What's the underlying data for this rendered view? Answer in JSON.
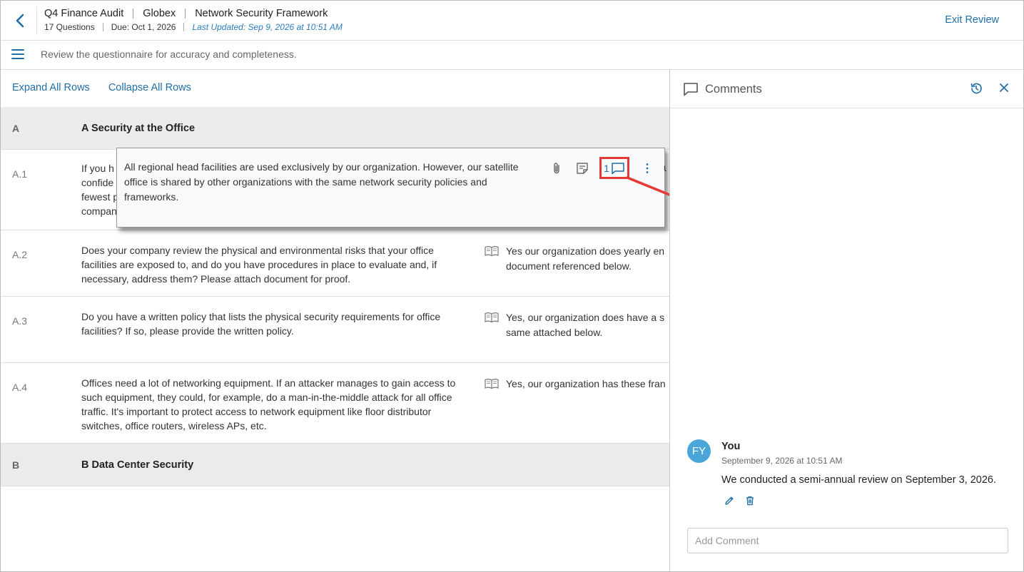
{
  "header": {
    "project": "Q4 Finance Audit",
    "company": "Globex",
    "framework": "Network Security Framework",
    "question_count": "17 Questions",
    "due": "Due: Oct 1, 2026",
    "last_updated": "Last Updated: Sep 9, 2026 at 10:51 AM",
    "exit_label": "Exit Review"
  },
  "subbar": {
    "instruction": "Review the questionnaire for accuracy and completeness."
  },
  "toolbar": {
    "expand_all": "Expand All Rows",
    "collapse_all": "Collapse All Rows"
  },
  "sections": [
    {
      "code": "A",
      "name": "A Security at the Office"
    },
    {
      "code": "B",
      "name": "B Data Center Security"
    }
  ],
  "questions": [
    {
      "code": "A.1",
      "text_lines": [
        "If you h",
        "confide",
        "fewest p",
        "compan"
      ]
    },
    {
      "code": "A.2",
      "text": "Does your company review the physical and environmental risks that your office facilities are exposed to, and do you have procedures in place to evaluate and, if necessary, address them? Please attach document for proof.",
      "answer_lines": [
        "Yes our organization does yearly en",
        "document referenced below."
      ]
    },
    {
      "code": "A.3",
      "text": "Do you have a written policy that lists the physical security requirements for office facilities? If so, please provide the written policy.",
      "answer_lines": [
        "Yes, our organization does have a s",
        "same attached below."
      ]
    },
    {
      "code": "A.4",
      "text": "Offices need a lot of networking equipment. If an attacker manages to gain access to such equipment, they could, for example, do a man-in-the-middle attack for all office traffic. It's important to protect access to network equipment like floor distributor switches, office routers, wireless APs, etc.",
      "answer_lines": [
        "Yes, our organization has these fran"
      ]
    }
  ],
  "popover": {
    "answer_text": "All regional head facilities are used exclusively by our organization. However, our satellite office is shared by other organizations with the same network security policies and frameworks.",
    "comment_count": "1",
    "peek_char": "u"
  },
  "comments_panel": {
    "title": "Comments",
    "comments": [
      {
        "avatar_initials": "FY",
        "author": "You",
        "timestamp": "September 9, 2026 at 10:51 AM",
        "body": "We conducted a semi-annual review on September 3, 2026."
      }
    ],
    "add_placeholder": "Add Comment"
  },
  "colors": {
    "accent": "#1f6ea8",
    "avatar": "#4aa6d8",
    "highlight": "#e53935",
    "section_bg": "#ebebeb"
  },
  "icons": [
    "back-chevron-icon",
    "menu-icon",
    "book-icon",
    "paperclip-icon",
    "note-icon",
    "comment-icon",
    "more-vertical-icon",
    "history-icon",
    "close-icon",
    "pencil-icon",
    "trash-icon"
  ]
}
